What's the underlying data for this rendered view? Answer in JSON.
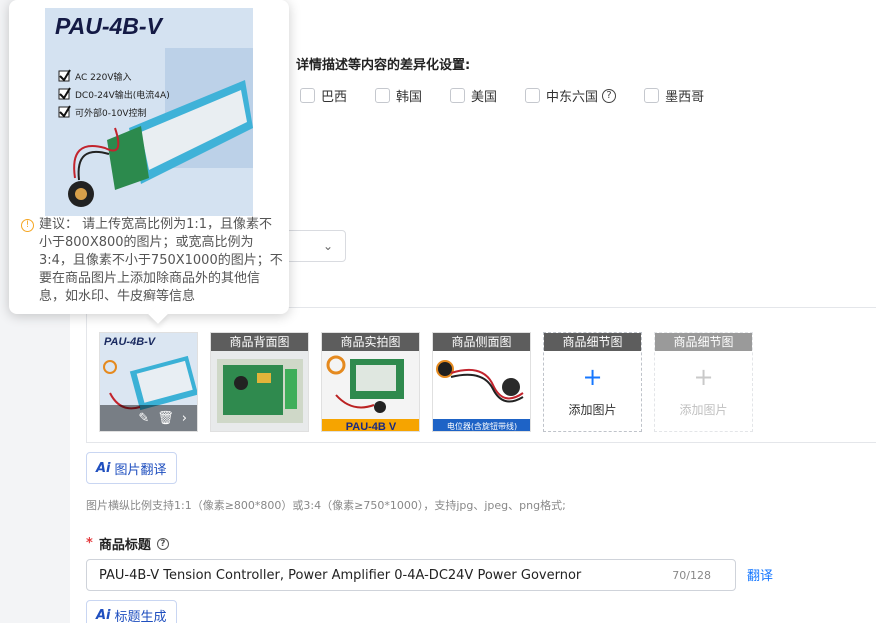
{
  "region_settings": {
    "title": "详情描述等内容的差异化设置:",
    "countries": [
      {
        "label": "巴西",
        "checked": false
      },
      {
        "label": "韩国",
        "checked": false
      },
      {
        "label": "美国",
        "checked": false
      },
      {
        "label": "中东六国",
        "checked": false,
        "help": true
      },
      {
        "label": "墨西哥",
        "checked": false
      }
    ]
  },
  "images": {
    "slots": [
      {
        "caption": "",
        "state": "filled",
        "model_text": "PAU-4B-V"
      },
      {
        "caption": "商品背面图",
        "state": "filled"
      },
      {
        "caption": "商品实拍图",
        "state": "filled",
        "model_text": "PAU-4B V"
      },
      {
        "caption": "商品侧面图",
        "state": "filled",
        "footer_text": "电位器(含旋钮带线)"
      },
      {
        "caption": "商品细节图",
        "state": "empty",
        "add_label": "添加图片"
      },
      {
        "caption": "商品细节图",
        "state": "disabled",
        "add_label": "添加图片"
      }
    ],
    "translate_button": "图片翻译",
    "hint": "图片横纵比例支持1:1（像素≥800*800）或3:4（像素≥750*1000），支持jpg、jpeg、png格式;"
  },
  "product_title": {
    "label": "商品标题",
    "value": "PAU-4B-V Tension Controller, Power Amplifier 0-4A-DC24V Power Governor",
    "count": "70/128",
    "translate_link": "翻译",
    "generate_button": "标题生成"
  },
  "popover": {
    "model": "PAU-4B-V",
    "features": [
      "AC 220V输入",
      "DC0-24V输出(电流4A)",
      "可外部0-10V控制"
    ],
    "tip": "建议：  请上传宽高比例为1:1，且像素不小于800X800的图片；或宽高比例为3:4，且像素不小于750X1000的图片；不要在商品图片上添加除商品外的其他信息，如水印、牛皮癣等信息"
  },
  "colors": {
    "accent": "#1677ff",
    "required": "#e4393c",
    "warning": "#f5a623"
  }
}
